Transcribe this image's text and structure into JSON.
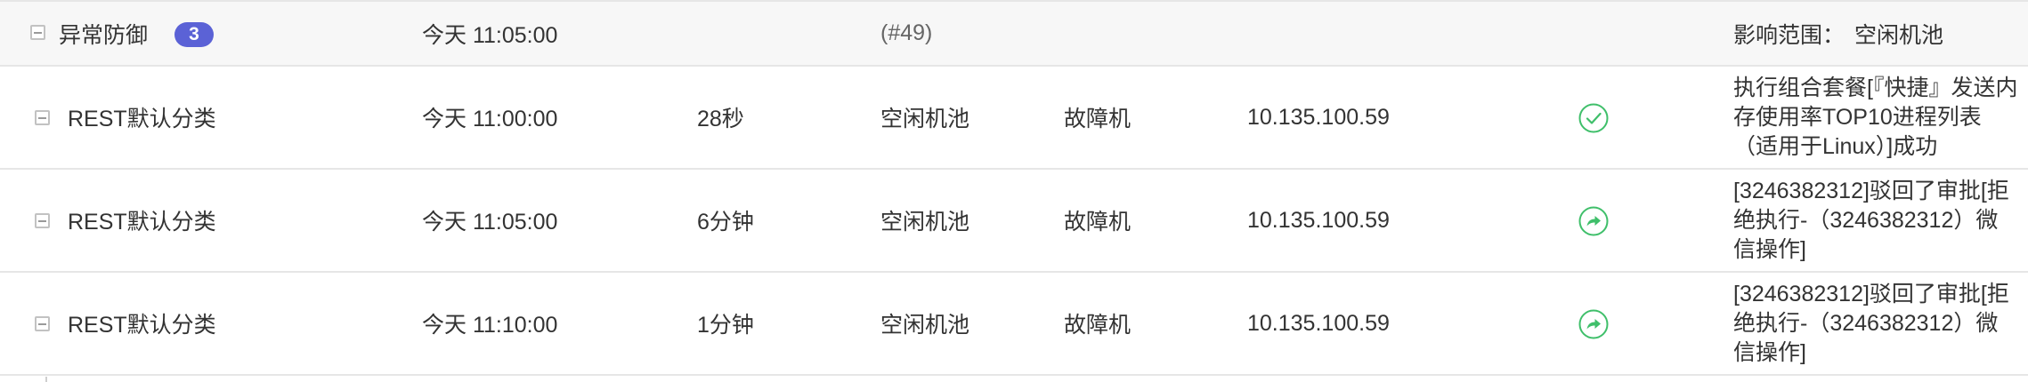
{
  "group": {
    "title": "异常防御",
    "count": "3",
    "time": "今天 11:05:00",
    "ref": "(#49)",
    "scope_label": "影响范围：",
    "scope_value": "空闲机池"
  },
  "rows": [
    {
      "category": "REST默认分类",
      "time": "今天 11:00:00",
      "duration": "28秒",
      "pool": "空闲机池",
      "status_text": "故障机",
      "ip": "10.135.100.59",
      "status_icon": "check-circle-icon",
      "message": "执行组合套餐[『快捷』发送内存使用率TOP10进程列表（适用于Linux）]成功"
    },
    {
      "category": "REST默认分类",
      "time": "今天 11:05:00",
      "duration": "6分钟",
      "pool": "空闲机池",
      "status_text": "故障机",
      "ip": "10.135.100.59",
      "status_icon": "forward-circle-icon",
      "message": "[3246382312]驳回了审批[拒绝执行-（3246382312）微信操作]"
    },
    {
      "category": "REST默认分类",
      "time": "今天 11:10:00",
      "duration": "1分钟",
      "pool": "空闲机池",
      "status_text": "故障机",
      "ip": "10.135.100.59",
      "status_icon": "forward-circle-icon",
      "message": "[3246382312]驳回了审批[拒绝执行-（3246382312）微信操作]"
    }
  ],
  "colors": {
    "badge": "#5b62d6",
    "success": "#3fbf6a",
    "border": "#e6e6e6",
    "group_bg": "#f7f7f7"
  }
}
